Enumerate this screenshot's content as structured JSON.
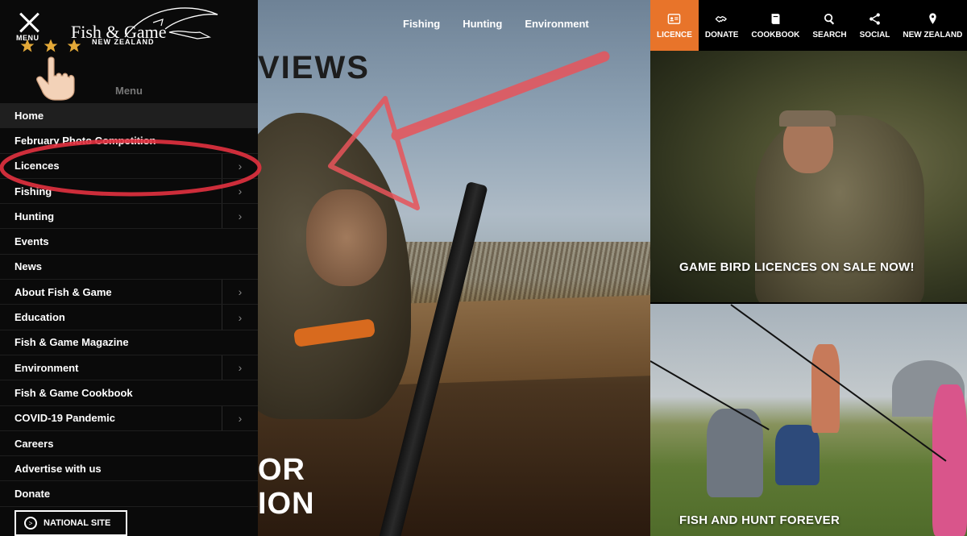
{
  "header": {
    "close_label": "MENU",
    "brand_name": "Fish & Game",
    "brand_sub": "NEW ZEALAND"
  },
  "menu": {
    "title": "Menu",
    "items": [
      {
        "label": "Home",
        "has_children": false,
        "active": true
      },
      {
        "label": "February Photo Competition",
        "has_children": false
      },
      {
        "label": "Licences",
        "has_children": true
      },
      {
        "label": "Fishing",
        "has_children": true
      },
      {
        "label": "Hunting",
        "has_children": true
      },
      {
        "label": "Events",
        "has_children": false
      },
      {
        "label": "News",
        "has_children": false
      },
      {
        "label": "About Fish & Game",
        "has_children": true
      },
      {
        "label": "Education",
        "has_children": true
      },
      {
        "label": "Fish & Game Magazine",
        "has_children": false
      },
      {
        "label": "Environment",
        "has_children": true
      },
      {
        "label": "Fish & Game Cookbook",
        "has_children": false
      },
      {
        "label": "COVID-19 Pandemic",
        "has_children": true
      },
      {
        "label": "Careers",
        "has_children": false
      },
      {
        "label": "Advertise with us",
        "has_children": false
      },
      {
        "label": "Donate",
        "has_children": false
      }
    ],
    "national_site_label": "NATIONAL SITE"
  },
  "topnav": {
    "links": [
      "Fishing",
      "Hunting",
      "Environment"
    ]
  },
  "iconbar": {
    "items": [
      {
        "label": "LICENCE",
        "icon": "licence-card-icon",
        "active": true
      },
      {
        "label": "DONATE",
        "icon": "handshake-icon"
      },
      {
        "label": "COOKBOOK",
        "icon": "book-icon"
      },
      {
        "label": "SEARCH",
        "icon": "search-icon"
      },
      {
        "label": "SOCIAL",
        "icon": "share-icon"
      },
      {
        "label": "NEW ZEALAND",
        "icon": "map-pin-icon"
      }
    ],
    "accent_color": "#e8742a"
  },
  "hero": {
    "title_fragment": "VIEWS",
    "subtitle_line1": "OR",
    "subtitle_line2": "ION"
  },
  "panels": {
    "top_caption": "GAME BIRD LICENCES ON SALE NOW!",
    "bottom_caption": "FISH AND HUNT FOREVER"
  },
  "annotations": {
    "rating_stars": 3,
    "highlight_color": "#e2313f"
  }
}
